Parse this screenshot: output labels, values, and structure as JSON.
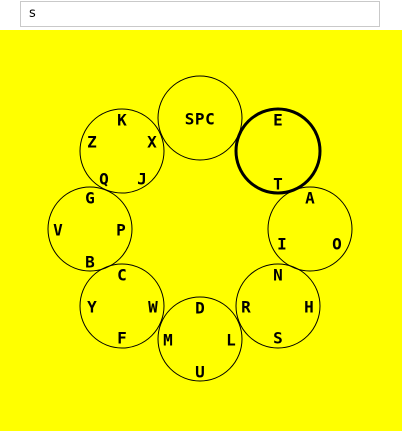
{
  "input": {
    "value": "s"
  },
  "colors": {
    "background": "#ffff00",
    "stroke": "#000000"
  },
  "wheel": {
    "selected_index": 1,
    "circles": [
      {
        "name": "circle-spc",
        "letters": [
          "SPC"
        ]
      },
      {
        "name": "circle-e-t",
        "letters": [
          "E",
          "T"
        ]
      },
      {
        "name": "circle-a-i-o",
        "letters": [
          "A",
          "I",
          "O"
        ]
      },
      {
        "name": "circle-n-r-h-s",
        "letters": [
          "N",
          "R",
          "H",
          "S"
        ]
      },
      {
        "name": "circle-d-m-l-u",
        "letters": [
          "D",
          "M",
          "L",
          "U"
        ]
      },
      {
        "name": "circle-c-y-w-f",
        "letters": [
          "C",
          "Y",
          "W",
          "F"
        ]
      },
      {
        "name": "circle-g-v-p-b",
        "letters": [
          "G",
          "V",
          "P",
          "B"
        ]
      },
      {
        "name": "circle-k-z-x-q-j",
        "letters": [
          "K",
          "Z",
          "X",
          "Q",
          "J"
        ]
      }
    ]
  }
}
